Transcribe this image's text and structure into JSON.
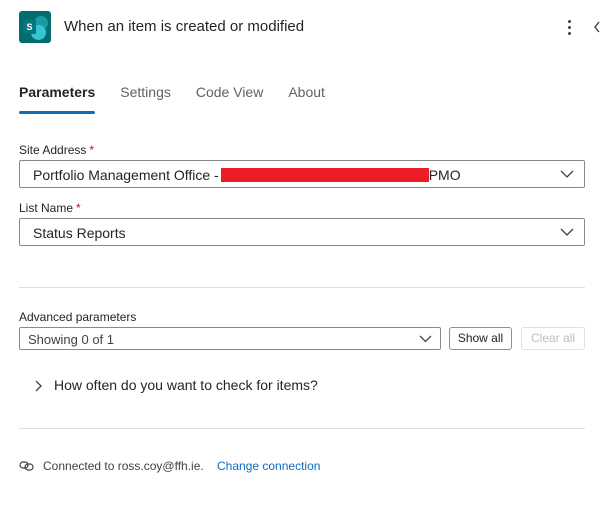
{
  "header": {
    "title": "When an item is created or modified",
    "app_icon_letter": "S",
    "app_icon": "sharepoint-icon",
    "more_icon": "more-vertical-icon",
    "collapse_icon": "chevron-left-icon"
  },
  "tabs": [
    {
      "label": "Parameters",
      "active": true
    },
    {
      "label": "Settings",
      "active": false
    },
    {
      "label": "Code View",
      "active": false
    },
    {
      "label": "About",
      "active": false
    }
  ],
  "site_address": {
    "label": "Site Address",
    "required_mark": "*",
    "value_prefix": "Portfolio Management Office -",
    "value_suffix": "PMO",
    "redacted": true
  },
  "list_name": {
    "label": "List Name",
    "required_mark": "*",
    "value": "Status Reports"
  },
  "advanced": {
    "label": "Advanced parameters",
    "value": "Showing 0 of 1",
    "show_all": "Show all",
    "clear_all": "Clear all"
  },
  "expander": {
    "label": "How often do you want to check for items?"
  },
  "connection": {
    "text": "Connected to ross.coy@ffh.ie.",
    "link": "Change connection",
    "icon": "connection-link-icon"
  },
  "colors": {
    "accent": "#0f6cbd",
    "required": "#c50f1f",
    "redaction": "#ee1c25",
    "sharepoint": "#036c70"
  }
}
